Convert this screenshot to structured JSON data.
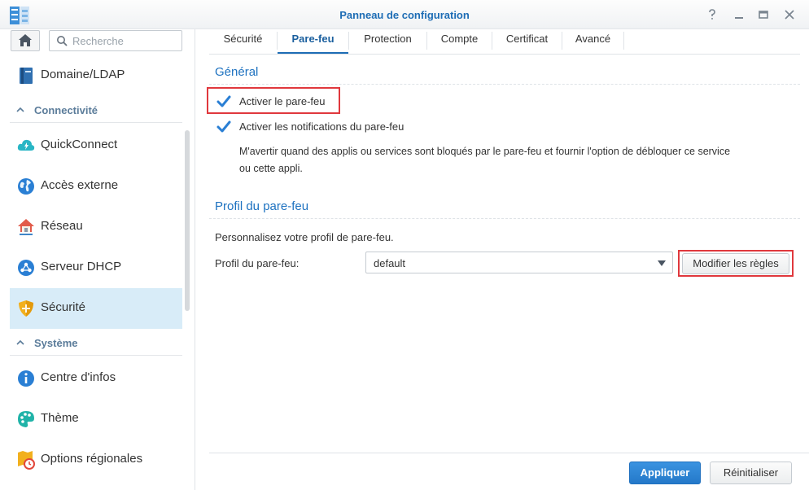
{
  "window": {
    "title": "Panneau de configuration",
    "controls": [
      "help-icon",
      "minimize-icon",
      "maximize-icon",
      "close-icon"
    ]
  },
  "sidebar": {
    "search_placeholder": "Recherche",
    "items": [
      {
        "label": "Domaine/LDAP",
        "icon": "directory-icon"
      },
      {
        "section": "Connectivité"
      },
      {
        "label": "QuickConnect",
        "icon": "quickconnect-icon"
      },
      {
        "label": "Accès externe",
        "icon": "globe-icon"
      },
      {
        "label": "Réseau",
        "icon": "network-house-icon"
      },
      {
        "label": "Serveur DHCP",
        "icon": "dhcp-icon"
      },
      {
        "label": "Sécurité",
        "icon": "shield-icon",
        "active": true
      },
      {
        "section": "Système"
      },
      {
        "label": "Centre d'infos",
        "icon": "info-icon"
      },
      {
        "label": "Thème",
        "icon": "palette-icon"
      },
      {
        "label": "Options régionales",
        "icon": "regional-clock-icon"
      }
    ]
  },
  "tabs": [
    {
      "label": "Sécurité"
    },
    {
      "label": "Pare-feu",
      "active": true
    },
    {
      "label": "Protection"
    },
    {
      "label": "Compte"
    },
    {
      "label": "Certificat"
    },
    {
      "label": "Avancé"
    }
  ],
  "general": {
    "title": "Général",
    "enable_firewall": {
      "label": "Activer le pare-feu",
      "checked": true
    },
    "enable_notifications": {
      "label": "Activer les notifications du pare-feu",
      "checked": true
    },
    "description_line1": "M'avertir quand des applis ou services sont bloqués par le pare-feu et fournir l'option de débloquer ce service",
    "description_line2": "ou cette appli."
  },
  "profile": {
    "title": "Profil du pare-feu",
    "intro": "Personnalisez votre profil de pare-feu.",
    "field_label": "Profil du pare-feu:",
    "selected": "default",
    "edit_rules_label": "Modifier les règles"
  },
  "footer": {
    "apply_label": "Appliquer",
    "reset_label": "Réinitialiser"
  },
  "colors": {
    "accent": "#1e72c0",
    "active_item_bg": "#d8ecf8",
    "highlight_box": "#e0383d",
    "checkmark": "#2a7fd4"
  }
}
